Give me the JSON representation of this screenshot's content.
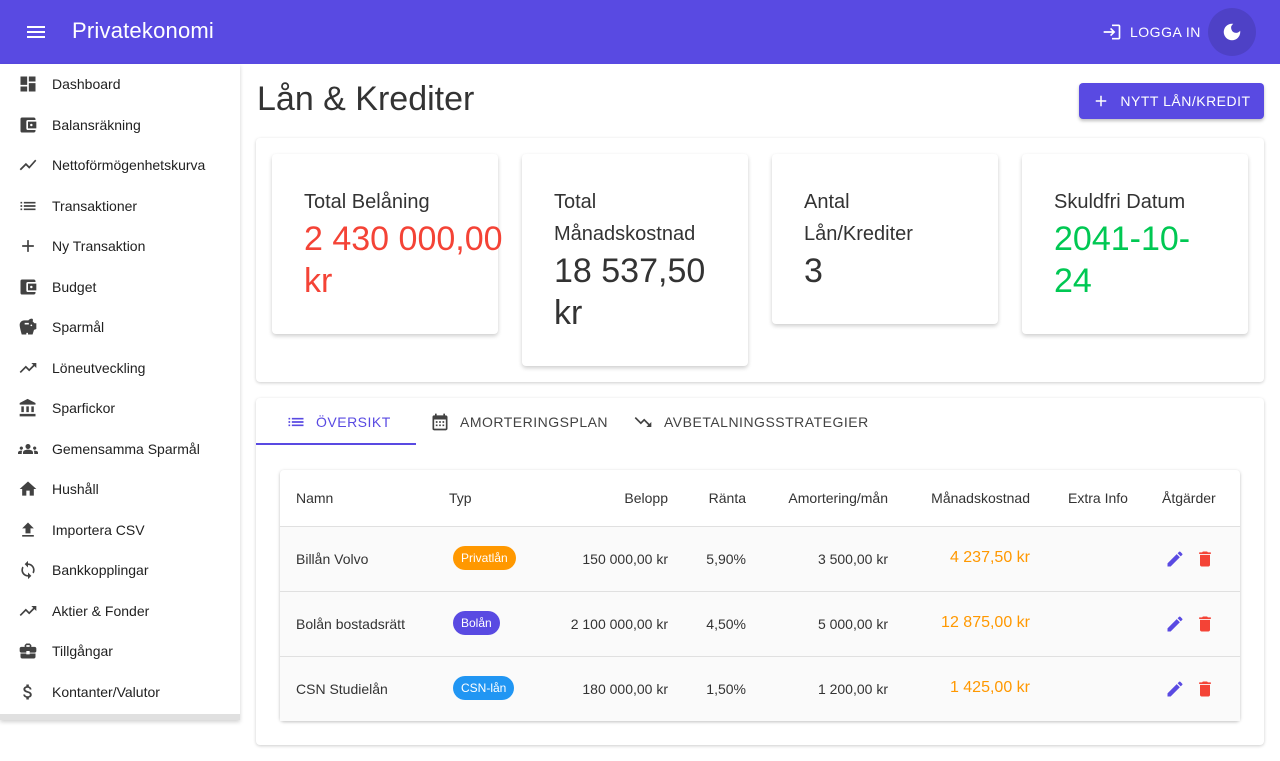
{
  "app": {
    "title": "Privatekonomi",
    "login_label": "LOGGA IN"
  },
  "sidebar": {
    "items": [
      {
        "label": "Dashboard",
        "icon": "dashboard-icon"
      },
      {
        "label": "Balansräkning",
        "icon": "wallet-icon"
      },
      {
        "label": "Nettoförmögenhetskurva",
        "icon": "trending-line-icon"
      },
      {
        "label": "Transaktioner",
        "icon": "list-icon"
      },
      {
        "label": "Ny Transaktion",
        "icon": "plus-icon"
      },
      {
        "label": "Budget",
        "icon": "wallet-icon"
      },
      {
        "label": "Sparmål",
        "icon": "piggy-bank-icon"
      },
      {
        "label": "Löneutveckling",
        "icon": "trending-up-icon"
      },
      {
        "label": "Sparfickor",
        "icon": "bank-icon"
      },
      {
        "label": "Gemensamma Sparmål",
        "icon": "group-icon"
      },
      {
        "label": "Hushåll",
        "icon": "home-icon"
      },
      {
        "label": "Importera CSV",
        "icon": "upload-icon"
      },
      {
        "label": "Bankkopplingar",
        "icon": "sync-icon"
      },
      {
        "label": "Aktier & Fonder",
        "icon": "trending-up-icon"
      },
      {
        "label": "Tillgångar",
        "icon": "briefcase-icon"
      },
      {
        "label": "Kontanter/Valutor",
        "icon": "dollar-icon"
      }
    ]
  },
  "main": {
    "title": "Lån & Krediter",
    "new_button_label": "NYTT LÅN/KREDIT",
    "stats": [
      {
        "label": "Total Belåning",
        "value": "2 430 000,00 kr",
        "color": "#f44336"
      },
      {
        "label": "Total Månadskostnad",
        "value": "18 537,50 kr",
        "color": "#333333"
      },
      {
        "label": "Antal Lån/Krediter",
        "value": "3",
        "color": "#333333"
      },
      {
        "label": "Skuldfri Datum",
        "value": "2041-10-24",
        "color": "#00c853"
      }
    ],
    "tabs": [
      {
        "label": "ÖVERSIKT",
        "icon": "list-icon",
        "active": true
      },
      {
        "label": "AMORTERINGSPLAN",
        "icon": "calendar-icon",
        "active": false
      },
      {
        "label": "AVBETALNINGSSTRATEGIER",
        "icon": "trending-down-icon",
        "active": false
      }
    ],
    "table": {
      "headers": [
        "Namn",
        "Typ",
        "Belopp",
        "Ränta",
        "Amortering/mån",
        "Månadskostnad",
        "Extra Info",
        "Åtgärder"
      ],
      "rows": [
        {
          "name": "Billån Volvo",
          "type": "Privatlån",
          "type_color": "#ff9800",
          "amount": "150 000,00 kr",
          "rate": "5,90%",
          "amortization": "3 500,00 kr",
          "monthly_cost": "4 237,50 kr"
        },
        {
          "name": "Bolån bostadsrätt",
          "type": "Bolån",
          "type_color": "#594ae2",
          "amount": "2 100 000,00 kr",
          "rate": "4,50%",
          "amortization": "5 000,00 kr",
          "monthly_cost": "12 875,00 kr"
        },
        {
          "name": "CSN Studielån",
          "type": "CSN-lån",
          "type_color": "#2196f3",
          "amount": "180 000,00 kr",
          "rate": "1,50%",
          "amortization": "1 200,00 kr",
          "monthly_cost": "1 425,00 kr"
        }
      ]
    }
  },
  "colors": {
    "primary": "#594ae2",
    "error": "#f44336",
    "success": "#00c853",
    "warning": "#ff9800"
  }
}
